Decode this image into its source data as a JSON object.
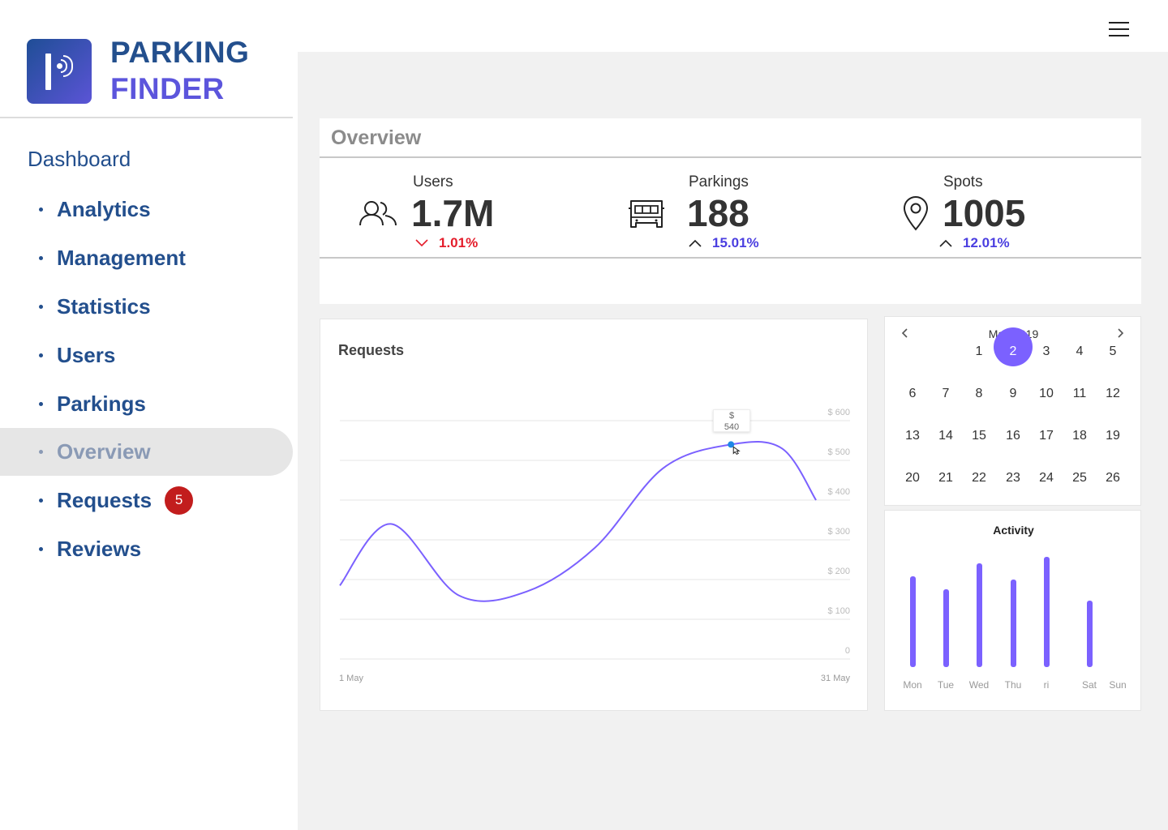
{
  "brand": {
    "line1": "PARKING",
    "line2": "FINDER",
    "logo_icon": "parking-signal-icon"
  },
  "nav": {
    "heading": "Dashboard",
    "items": [
      {
        "label": "Analytics"
      },
      {
        "label": "Management"
      },
      {
        "label": "Statistics"
      },
      {
        "label": "Users"
      },
      {
        "label": "Parkings"
      },
      {
        "label": "Overview",
        "active": true
      },
      {
        "label": "Requests",
        "badge": "5"
      },
      {
        "label": "Reviews"
      }
    ]
  },
  "topbar": {
    "menu_icon": "hamburger-menu-icon"
  },
  "overview": {
    "title": "Overview",
    "stats": [
      {
        "label": "Users",
        "value": "1.7M",
        "change": "1.01%",
        "trend": "down",
        "icon": "users-icon"
      },
      {
        "label": "Parkings",
        "value": "188",
        "change": "15.01%",
        "trend": "up",
        "icon": "car-icon"
      },
      {
        "label": "Spots",
        "value": "1005",
        "change": "12.01%",
        "trend": "up",
        "icon": "location-pin-icon"
      }
    ]
  },
  "requests": {
    "title": "Requests",
    "tooltip": {
      "line1": "$",
      "line2": "540"
    },
    "chart_data": {
      "type": "line",
      "title": "Requests",
      "x_start_label": "1 May",
      "x_end_label": "31 May",
      "y_ticks": [
        "0",
        "$ 100",
        "$ 200",
        "$ 300",
        "$ 400",
        "$ 500",
        "$ 600"
      ],
      "ylim": [
        0,
        600
      ],
      "grid": true,
      "x": [
        1,
        4,
        8,
        12,
        16,
        20,
        24,
        27,
        29
      ],
      "values": [
        185,
        340,
        160,
        170,
        280,
        480,
        540,
        530,
        400
      ],
      "highlight": {
        "x": 24,
        "value": 540
      }
    }
  },
  "calendar": {
    "title": "May 2019",
    "prev_icon": "chevron-left-icon",
    "next_icon": "chevron-right-icon",
    "selected": "2",
    "rows": [
      [
        "",
        "",
        "1",
        "2",
        "3",
        "4",
        "5"
      ],
      [
        "6",
        "7",
        "8",
        "9",
        "10",
        "11",
        "12"
      ],
      [
        "13",
        "14",
        "15",
        "16",
        "17",
        "18",
        "19"
      ],
      [
        "20",
        "21",
        "22",
        "23",
        "24",
        "25",
        "26"
      ]
    ]
  },
  "activity": {
    "title": "Activity",
    "chart_data": {
      "type": "bar",
      "title": "Activity",
      "categories": [
        "Mon",
        "Tue",
        "Wed",
        "Thu",
        "ri",
        "Sat",
        "Sun"
      ],
      "values": [
        112,
        96,
        128,
        108,
        136,
        82,
        0
      ],
      "color": "#7b61ff"
    }
  }
}
